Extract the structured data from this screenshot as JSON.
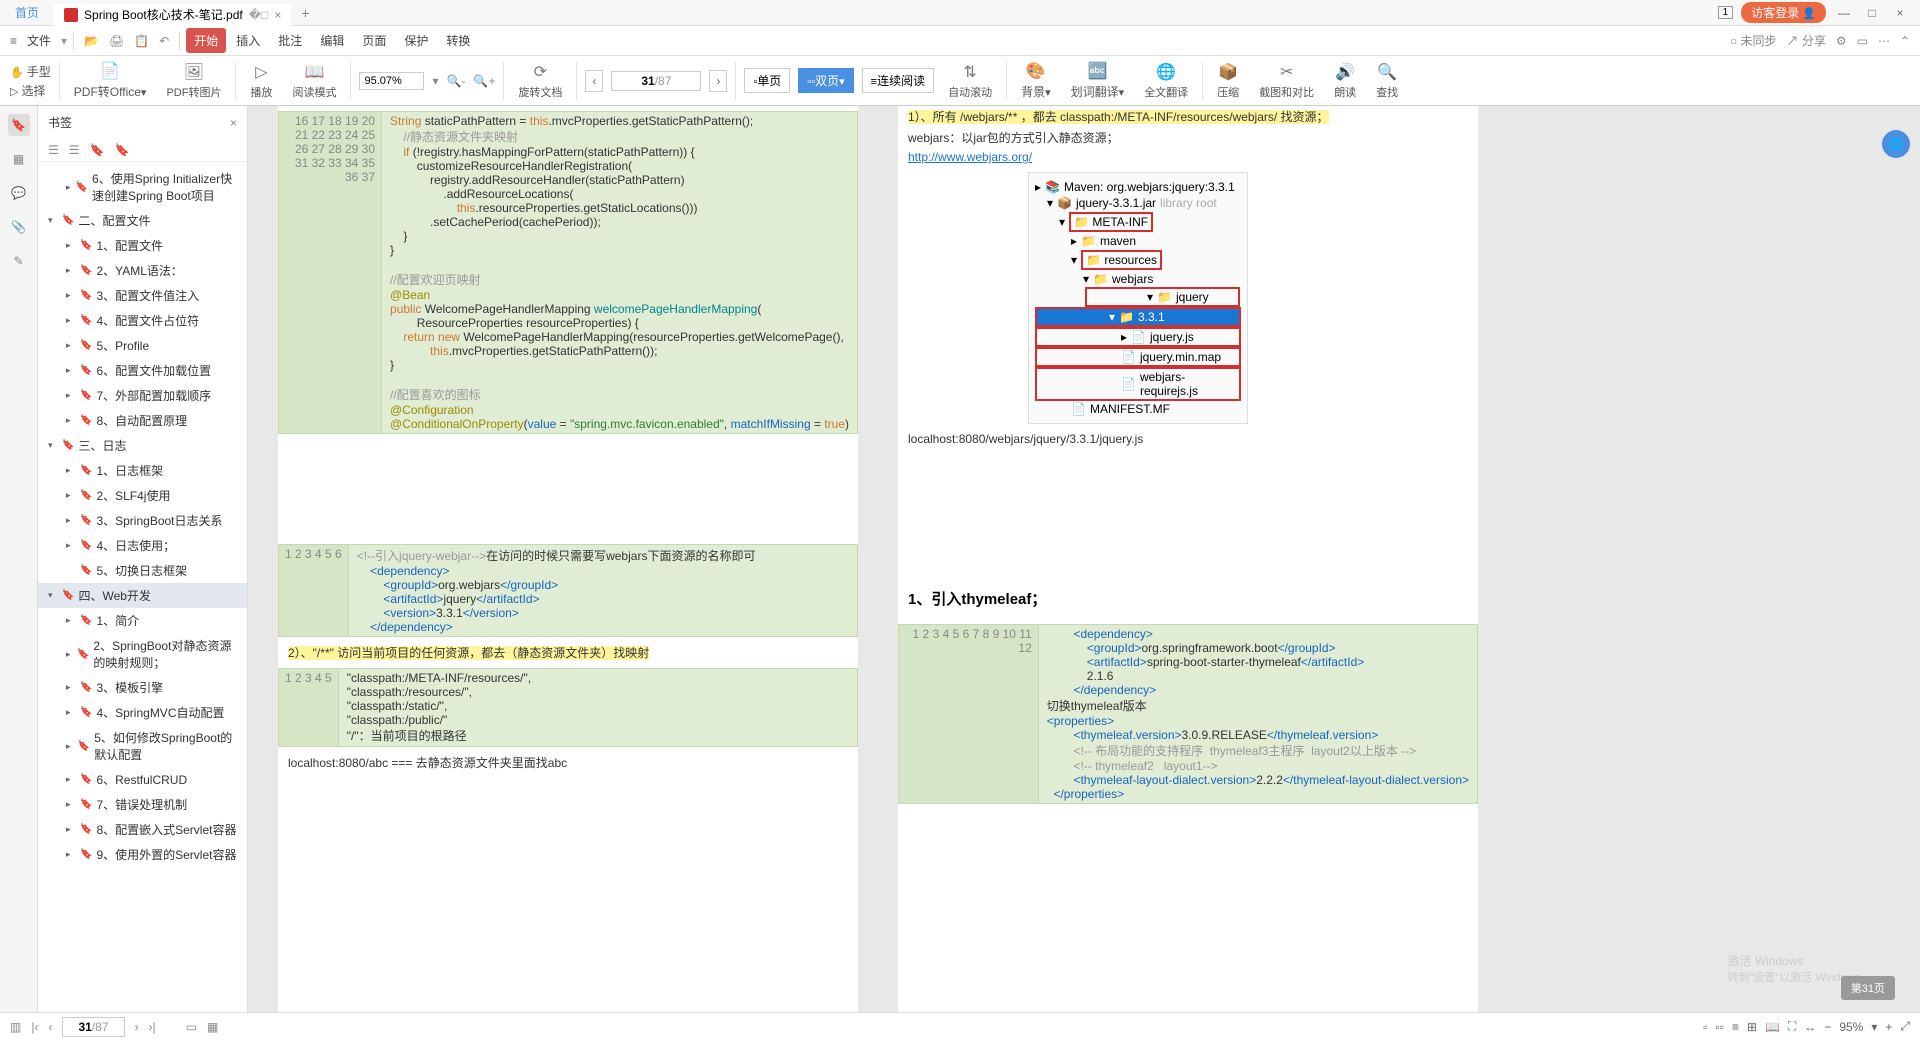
{
  "titlebar": {
    "home": "首页",
    "filename": "Spring Boot核心技术-笔记.pdf",
    "badge": "1",
    "guest": "访客登录"
  },
  "menubar": {
    "file": "文件",
    "items": [
      "开始",
      "插入",
      "批注",
      "编辑",
      "页面",
      "保护",
      "转换"
    ],
    "right": {
      "unsync": "未同步",
      "share": "分享"
    }
  },
  "toolbar": {
    "hand": "手型",
    "select": "选择",
    "pdf2office": "PDF转Office",
    "pdf2img": "PDF转图片",
    "play": "播放",
    "readmode": "阅读模式",
    "zoom": "95.07%",
    "pagein": "31",
    "pagetotal": "/87",
    "rotate": "旋转文档",
    "single": "单页",
    "double": "双页",
    "contread": "连续阅读",
    "autoscroll": "自动滚动",
    "bg": "背景",
    "wordtrans": "划词翻译",
    "fulltrans": "全文翻译",
    "compress": "压缩",
    "compare": "截图和对比",
    "read": "朗读",
    "find": "查找"
  },
  "bookmarks": {
    "title": "书签",
    "items": [
      {
        "lvl": 2,
        "arrow": "▸",
        "txt": "6、使用Spring Initializer快速创建Spring Boot项目"
      },
      {
        "lvl": 1,
        "arrow": "▾",
        "txt": "二、配置文件"
      },
      {
        "lvl": 2,
        "arrow": "▸",
        "txt": "1、配置文件"
      },
      {
        "lvl": 2,
        "arrow": "▸",
        "txt": "2、YAML语法："
      },
      {
        "lvl": 2,
        "arrow": "▸",
        "txt": "3、配置文件值注入"
      },
      {
        "lvl": 2,
        "arrow": "▸",
        "txt": "4、配置文件占位符"
      },
      {
        "lvl": 2,
        "arrow": "▸",
        "txt": "5、Profile"
      },
      {
        "lvl": 2,
        "arrow": "▸",
        "txt": "6、配置文件加载位置"
      },
      {
        "lvl": 2,
        "arrow": "▸",
        "txt": "7、外部配置加载顺序"
      },
      {
        "lvl": 2,
        "arrow": "▸",
        "txt": "8、自动配置原理"
      },
      {
        "lvl": 1,
        "arrow": "▾",
        "txt": "三、日志"
      },
      {
        "lvl": 2,
        "arrow": "▸",
        "txt": "1、日志框架"
      },
      {
        "lvl": 2,
        "arrow": "▸",
        "txt": "2、SLF4j使用"
      },
      {
        "lvl": 2,
        "arrow": "▸",
        "txt": "3、SpringBoot日志关系"
      },
      {
        "lvl": 2,
        "arrow": "▸",
        "txt": "4、日志使用；"
      },
      {
        "lvl": 2,
        "arrow": "",
        "txt": "5、切换日志框架"
      },
      {
        "lvl": 1,
        "arrow": "▾",
        "txt": "四、Web开发",
        "sel": true
      },
      {
        "lvl": 2,
        "arrow": "▸",
        "txt": "1、简介"
      },
      {
        "lvl": 2,
        "arrow": "▸",
        "txt": "2、SpringBoot对静态资源的映射规则；"
      },
      {
        "lvl": 2,
        "arrow": "▸",
        "txt": "3、模板引擎"
      },
      {
        "lvl": 2,
        "arrow": "▸",
        "txt": "4、SpringMVC自动配置"
      },
      {
        "lvl": 2,
        "arrow": "▸",
        "txt": "5、如何修改SpringBoot的默认配置"
      },
      {
        "lvl": 2,
        "arrow": "▸",
        "txt": "6、RestfulCRUD"
      },
      {
        "lvl": 2,
        "arrow": "▸",
        "txt": "7、错误处理机制"
      },
      {
        "lvl": 2,
        "arrow": "▸",
        "txt": "8、配置嵌入式Servlet容器"
      },
      {
        "lvl": 2,
        "arrow": "▸",
        "txt": "9、使用外置的Servlet容器"
      }
    ]
  },
  "page1": {
    "code1_lines": "16\n17\n18\n19\n20\n21\n22\n23\n24\n25\n26\n27\n28\n29\n30\n31\n32\n33\n34\n35\n36\n37",
    "code2_lines": "1\n2\n3\n4\n5\n6",
    "code2_comment": "<!--引入jquery-webjar-->",
    "code2_comment2": "在访问的时候只需要写webjars下面资源的名称即可",
    "heading2": "2）、\"/**\" 访问当前项目的任何资源，都去（静态资源文件夹）找映射",
    "code3_lines": "1\n2\n3\n4\n5",
    "code3_body": "\"classpath:/META-INF/resources/\",\n\"classpath:/resources/\",\n\"classpath:/static/\",\n\"classpath:/public/\"\n\"/\"：当前项目的根路径",
    "footer": "localhost:8080/abc === 去静态资源文件夹里面找abc"
  },
  "page2": {
    "heading1": "1）、所有 /webjars/** ，都去 classpath:/META-INF/resources/webjars/ 找资源；",
    "webjars_desc": "webjars：以jar包的方式引入静态资源；",
    "link": "http://www.webjars.org/",
    "tree": {
      "maven": "Maven: org.webjars:jquery:3.3.1",
      "jar": "jquery-3.3.1.jar",
      "libroot": "library root",
      "metainf": "META-INF",
      "mavenf": "maven",
      "resources": "resources",
      "webjars": "webjars",
      "jquery": "jquery",
      "ver": "3.3.1",
      "jqueryjs": "jquery.js",
      "jqmap": "jquery.min.map",
      "reqjs": "webjars-requirejs.js",
      "manifest": "MANIFEST.MF"
    },
    "localhost": "localhost:8080/webjars/jquery/3.3.1/jquery.js",
    "h3": "1、引入thymeleaf；",
    "code_lines": "1\n2\n3\n4\n5\n6\n7\n8\n9\n10\n11\n12",
    "switchver": "切换thymeleaf版本"
  },
  "statusbar": {
    "page": "31",
    "total": "/87",
    "zoom": "95%",
    "badge": "第31页"
  },
  "watermark": {
    "l1": "激活 Windows",
    "l2": "转到\"设置\"以激活 Windows"
  }
}
